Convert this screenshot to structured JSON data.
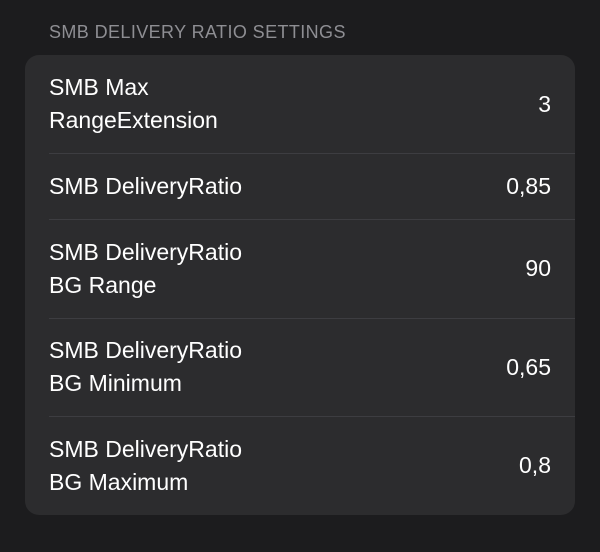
{
  "section": {
    "title": "SMB DELIVERY RATIO SETTINGS"
  },
  "rows": [
    {
      "label": "SMB Max\nRangeExtension",
      "value": "3"
    },
    {
      "label": "SMB DeliveryRatio",
      "value": "0,85"
    },
    {
      "label": "SMB DeliveryRatio\nBG Range",
      "value": "90"
    },
    {
      "label": "SMB DeliveryRatio\nBG Minimum",
      "value": "0,65"
    },
    {
      "label": "SMB DeliveryRatio\nBG Maximum",
      "value": "0,8"
    }
  ],
  "colors": {
    "background": "#1c1c1e",
    "card": "#2c2c2e",
    "header_text": "#8e8e93",
    "text": "#ffffff",
    "separator": "#3d3d41"
  }
}
